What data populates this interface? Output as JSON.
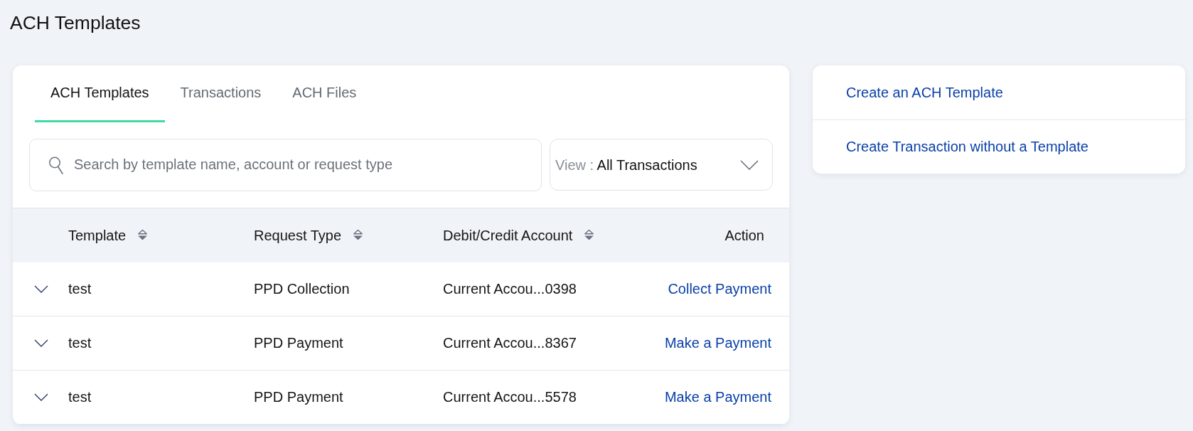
{
  "page": {
    "title": "ACH Templates"
  },
  "tabs": [
    {
      "label": "ACH Templates",
      "selected": true
    },
    {
      "label": "Transactions",
      "selected": false
    },
    {
      "label": "ACH Files",
      "selected": false
    }
  ],
  "search": {
    "placeholder": "Search by template name, account or request type"
  },
  "view_filter": {
    "label": "View :",
    "value": "All Transactions"
  },
  "table": {
    "columns": [
      {
        "label": "Template",
        "sortable": true
      },
      {
        "label": "Request Type",
        "sortable": true
      },
      {
        "label": "Debit/Credit Account",
        "sortable": true
      },
      {
        "label": "Action",
        "sortable": false
      }
    ],
    "rows": [
      {
        "expanded": false,
        "template": "test",
        "request_type": "PPD Collection",
        "account": "Current Accou...0398",
        "action": "Collect Payment"
      },
      {
        "expanded": false,
        "template": "test",
        "request_type": "PPD Payment",
        "account": "Current Accou...8367",
        "action": "Make a Payment"
      },
      {
        "expanded": false,
        "template": "test",
        "request_type": "PPD Payment",
        "account": "Current Accou...5578",
        "action": "Make a Payment"
      }
    ]
  },
  "quick_links": [
    "Create an ACH Template",
    "Create Transaction without a Template"
  ]
}
